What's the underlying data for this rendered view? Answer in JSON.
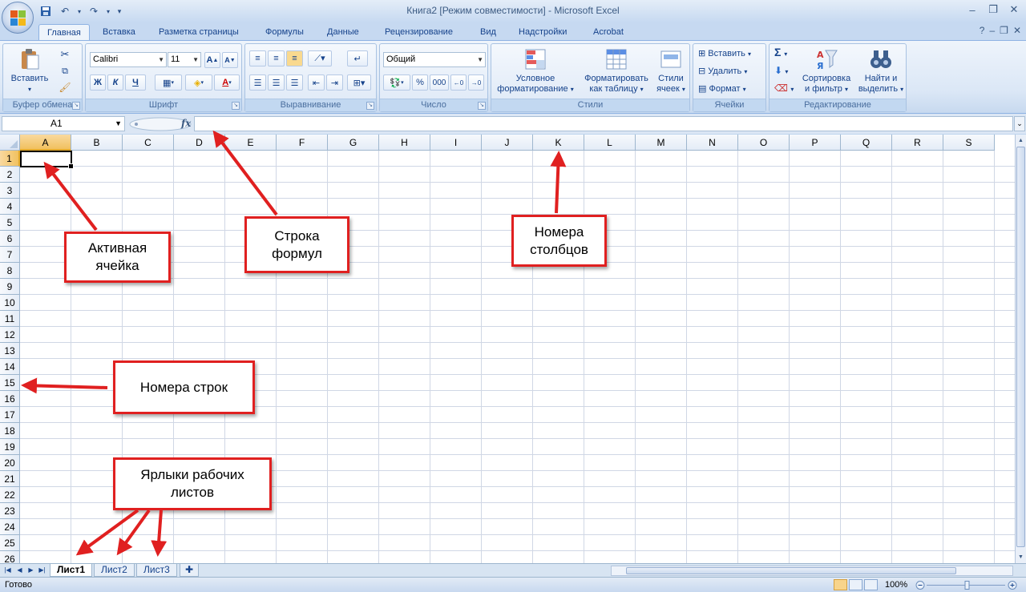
{
  "window": {
    "title": "Книга2  [Режим совместимости] - Microsoft Excel"
  },
  "ribbon_tabs": [
    "Главная",
    "Вставка",
    "Разметка страницы",
    "Формулы",
    "Данные",
    "Рецензирование",
    "Вид",
    "Надстройки",
    "Acrobat"
  ],
  "ribbon": {
    "clipboard": {
      "group_label": "Буфер обмена",
      "paste_label": "Вставить"
    },
    "font": {
      "group_label": "Шрифт",
      "font_name": "Calibri",
      "font_size": "11",
      "bold": "Ж",
      "italic": "К",
      "underline": "Ч"
    },
    "alignment": {
      "group_label": "Выравнивание"
    },
    "number": {
      "group_label": "Число",
      "format": "Общий",
      "percent": "%",
      "thousands": "000"
    },
    "styles": {
      "group_label": "Стили",
      "conditional_l1": "Условное",
      "conditional_l2": "форматирование",
      "format_table_l1": "Форматировать",
      "format_table_l2": "как таблицу",
      "cell_styles_l1": "Стили",
      "cell_styles_l2": "ячеек"
    },
    "cells": {
      "group_label": "Ячейки",
      "insert": "Вставить",
      "delete": "Удалить",
      "format": "Формат"
    },
    "editing": {
      "group_label": "Редактирование",
      "sort_l1": "Сортировка",
      "sort_l2": "и фильтр",
      "find_l1": "Найти и",
      "find_l2": "выделить"
    }
  },
  "formula_bar": {
    "name_box": "A1",
    "fx": "fx",
    "value": ""
  },
  "grid": {
    "columns": [
      "A",
      "B",
      "C",
      "D",
      "E",
      "F",
      "G",
      "H",
      "I",
      "J",
      "K",
      "L",
      "M",
      "N",
      "O",
      "P",
      "Q",
      "R",
      "S"
    ],
    "rows": [
      "1",
      "2",
      "3",
      "4",
      "5",
      "6",
      "7",
      "8",
      "9",
      "10",
      "11",
      "12",
      "13",
      "14",
      "15",
      "16",
      "17",
      "18",
      "19",
      "20",
      "21",
      "22",
      "23",
      "24",
      "25",
      "26"
    ],
    "active_cell": "A1"
  },
  "sheet_tabs": [
    "Лист1",
    "Лист2",
    "Лист3"
  ],
  "status": {
    "text": "Готово",
    "zoom": "100%"
  },
  "annotations": {
    "active_cell": "Активная\nячейка",
    "formula_bar": "Строка\nформул",
    "column_numbers": "Номера\nстолбцов",
    "row_numbers": "Номера строк",
    "sheet_tabs": "Ярлыки рабочих\nлистов",
    "arrow_color": "#e02020"
  }
}
